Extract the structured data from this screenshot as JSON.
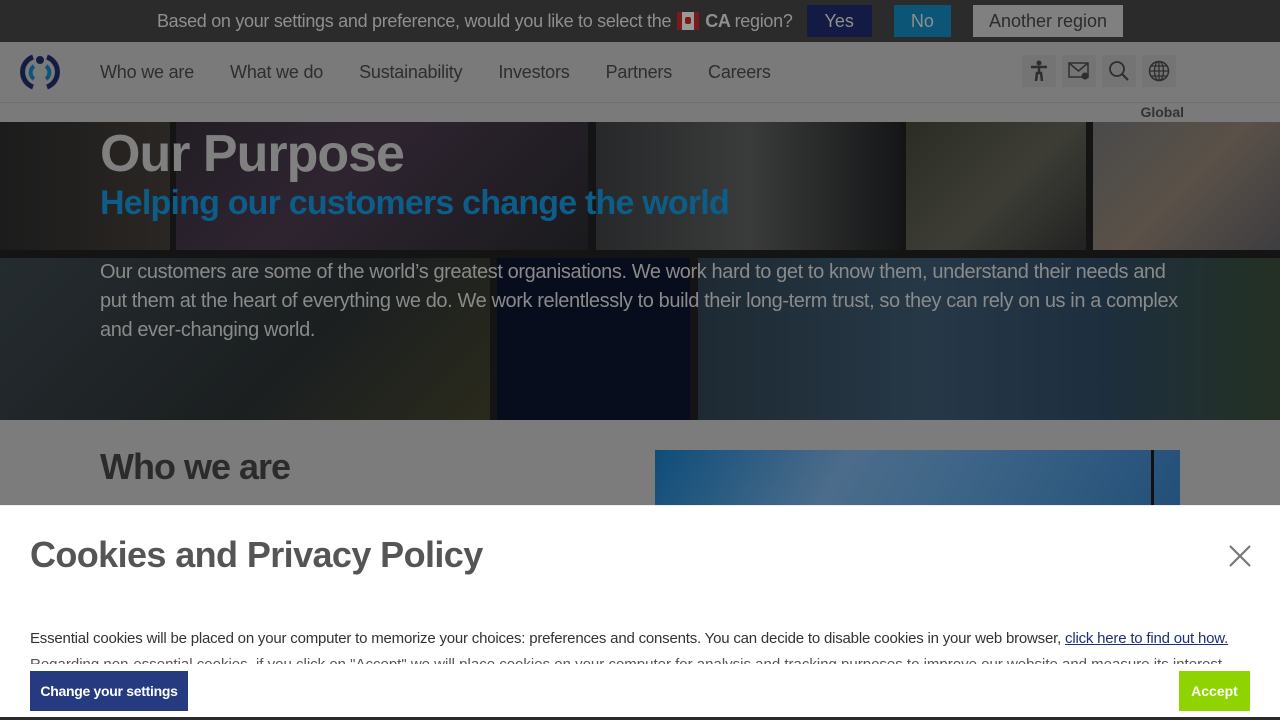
{
  "region_banner": {
    "message_before": "Based on your settings and preference, would you like to select the",
    "region_code": "CA",
    "message_after": "region?",
    "flag_icon": "canada-flag-icon",
    "yes_label": "Yes",
    "no_label": "No",
    "another_label": "Another region"
  },
  "header": {
    "logo": "company-logo",
    "nav": [
      {
        "label": "Who we are"
      },
      {
        "label": "What we do"
      },
      {
        "label": "Sustainability"
      },
      {
        "label": "Investors"
      },
      {
        "label": "Partners"
      },
      {
        "label": "Careers"
      }
    ],
    "tools": [
      {
        "icon": "accessibility-icon"
      },
      {
        "icon": "contact-mail-icon"
      },
      {
        "icon": "search-icon"
      },
      {
        "icon": "globe-icon"
      }
    ],
    "region_label": "Global"
  },
  "hero": {
    "title": "Our Purpose",
    "subtitle": "Helping our customers change the world",
    "body": "Our customers are some of the world’s greatest organisations. We work hard to get to know them, understand their needs and put them at the heart of everything we do. We work relentlessly to build their long-term trust, so they can rely on us in a complex and ever-changing world."
  },
  "who_we_are": {
    "title": "Who we are"
  },
  "cookie_banner": {
    "title": "Cookies and Privacy Policy",
    "paragraph1": "Essential cookies will be placed on your computer to memorize your choices: preferences and consents. You can decide to disable cookies in your web browser, ",
    "paragraph1_link": "click here to find out how.",
    "paragraph2": "Regarding non-essential cookies, if you click on \"Accept\" we will place cookies on your computer for analysis and tracking purposes to improve our website and measure its interest",
    "settings_label": "Change your settings",
    "accept_label": "Accept"
  },
  "colors": {
    "brand_navy": "#263a80",
    "brand_blue": "#0d5d88",
    "accept_green": "#8fd400"
  }
}
